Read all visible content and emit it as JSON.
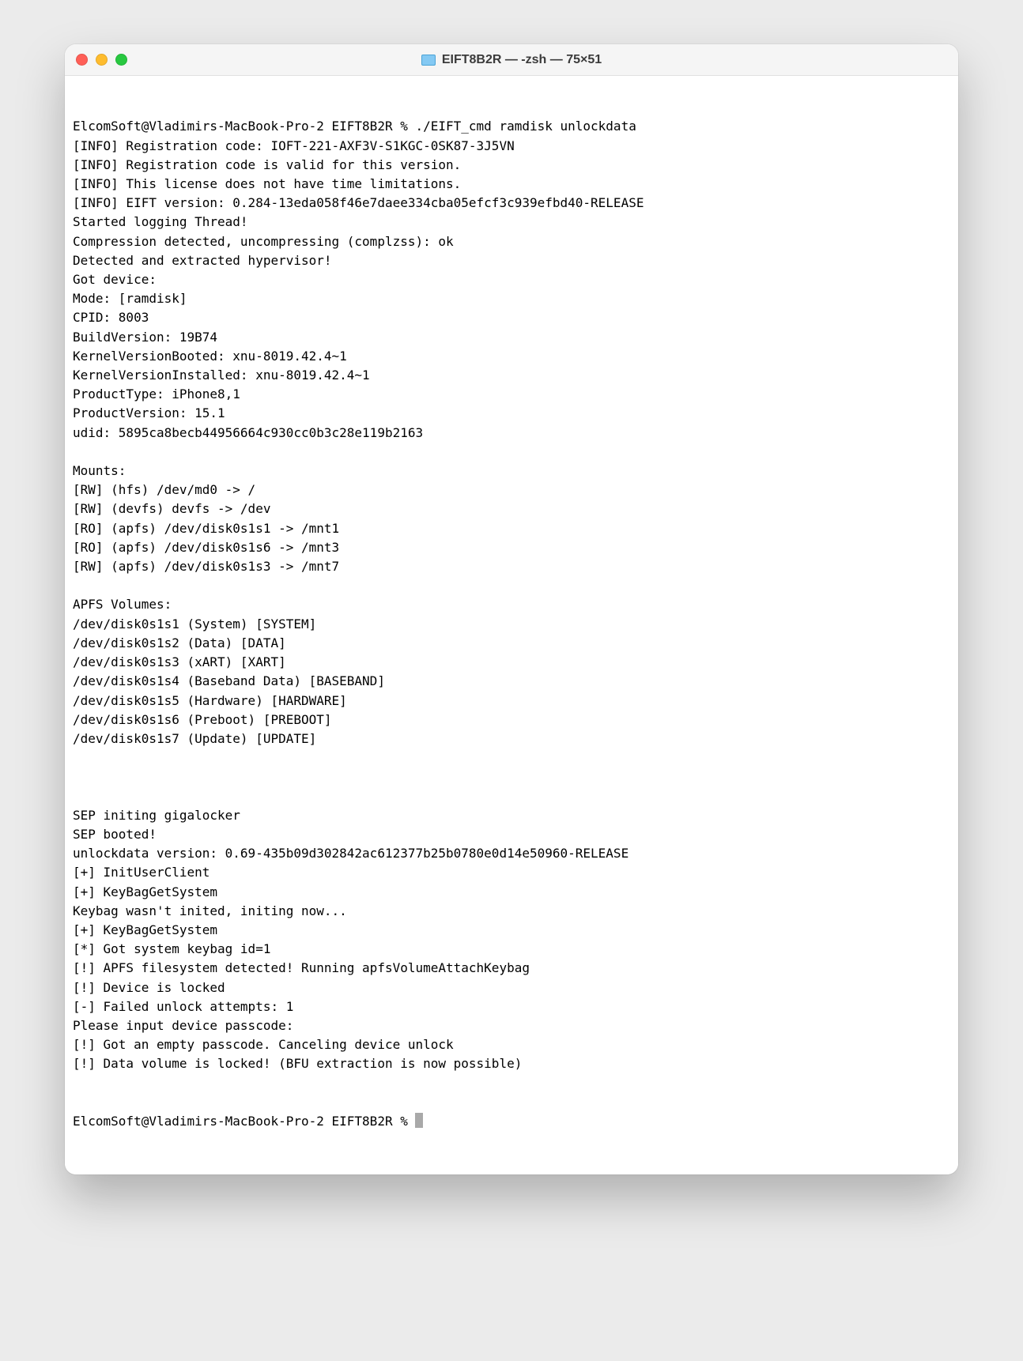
{
  "window": {
    "title": "EIFT8B2R — -zsh — 75×51"
  },
  "lines": [
    "ElcomSoft@Vladimirs-MacBook-Pro-2 EIFT8B2R % ./EIFT_cmd ramdisk unlockdata",
    "[INFO] Registration code: IOFT-221-AXF3V-S1KGC-0SK87-3J5VN",
    "[INFO] Registration code is valid for this version.",
    "[INFO] This license does not have time limitations.",
    "[INFO] EIFT version: 0.284-13eda058f46e7daee334cba05efcf3c939efbd40-RELEASE",
    "Started logging Thread!",
    "Compression detected, uncompressing (complzss): ok",
    "Detected and extracted hypervisor!",
    "Got device:",
    "Mode: [ramdisk]",
    "CPID: 8003",
    "BuildVersion: 19B74",
    "KernelVersionBooted: xnu-8019.42.4~1",
    "KernelVersionInstalled: xnu-8019.42.4~1",
    "ProductType: iPhone8,1",
    "ProductVersion: 15.1",
    "udid: 5895ca8becb44956664c930cc0b3c28e119b2163",
    "",
    "Mounts:",
    "[RW] (hfs) /dev/md0 -> /",
    "[RW] (devfs) devfs -> /dev",
    "[RO] (apfs) /dev/disk0s1s1 -> /mnt1",
    "[RO] (apfs) /dev/disk0s1s6 -> /mnt3",
    "[RW] (apfs) /dev/disk0s1s3 -> /mnt7",
    "",
    "APFS Volumes:",
    "/dev/disk0s1s1 (System) [SYSTEM]",
    "/dev/disk0s1s2 (Data) [DATA]",
    "/dev/disk0s1s3 (xART) [XART]",
    "/dev/disk0s1s4 (Baseband Data) [BASEBAND]",
    "/dev/disk0s1s5 (Hardware) [HARDWARE]",
    "/dev/disk0s1s6 (Preboot) [PREBOOT]",
    "/dev/disk0s1s7 (Update) [UPDATE]",
    "",
    "",
    "",
    "SEP initing gigalocker",
    "SEP booted!",
    "unlockdata version: 0.69-435b09d302842ac612377b25b0780e0d14e50960-RELEASE",
    "[+] InitUserClient",
    "[+] KeyBagGetSystem",
    "Keybag wasn't inited, initing now...",
    "[+] KeyBagGetSystem",
    "[*] Got system keybag id=1",
    "[!] APFS filesystem detected! Running apfsVolumeAttachKeybag",
    "[!] Device is locked",
    "[-] Failed unlock attempts: 1",
    "Please input device passcode:",
    "[!] Got an empty passcode. Canceling device unlock",
    "[!] Data volume is locked! (BFU extraction is now possible)"
  ],
  "prompt": "ElcomSoft@Vladimirs-MacBook-Pro-2 EIFT8B2R % "
}
